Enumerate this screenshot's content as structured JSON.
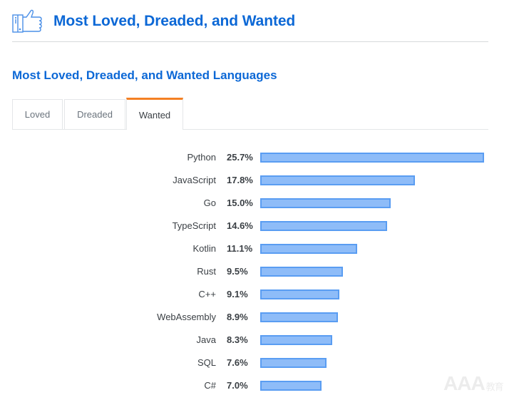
{
  "header": {
    "icon": "thumbs-up-icon",
    "title": "Most Loved, Dreaded, and Wanted"
  },
  "section": {
    "title": "Most Loved, Dreaded, and Wanted Languages"
  },
  "tabs": [
    {
      "label": "Loved",
      "active": false
    },
    {
      "label": "Dreaded",
      "active": false
    },
    {
      "label": "Wanted",
      "active": true
    }
  ],
  "colors": {
    "accent": "#0c68d6",
    "tab_active": "#f48024",
    "bar_fill": "#8ebcf8",
    "bar_border": "#5a9df2"
  },
  "watermark": {
    "text": "AAA",
    "sub": "教育"
  },
  "chart_data": {
    "type": "bar",
    "orientation": "horizontal",
    "title": "Most Loved, Dreaded, and Wanted Languages",
    "active_view": "Wanted",
    "categories": [
      "Python",
      "JavaScript",
      "Go",
      "TypeScript",
      "Kotlin",
      "Rust",
      "C++",
      "WebAssembly",
      "Java",
      "SQL",
      "C#"
    ],
    "values": [
      25.7,
      17.8,
      15.0,
      14.6,
      11.1,
      9.5,
      9.1,
      8.9,
      8.3,
      7.6,
      7.0
    ],
    "labels": [
      "25.7%",
      "17.8%",
      "15.0%",
      "14.6%",
      "11.1%",
      "9.5%",
      "9.1%",
      "8.9%",
      "8.3%",
      "7.6%",
      "7.0%"
    ],
    "unit": "%",
    "xlim": [
      0,
      25.7
    ],
    "grid": false,
    "legend": "none"
  }
}
